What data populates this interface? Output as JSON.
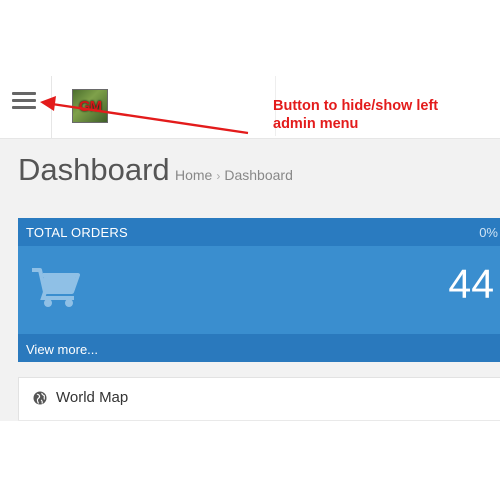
{
  "header": {
    "menu_toggle_icon": "hamburger-icon",
    "logo_text": "GM"
  },
  "annotation": {
    "line1": "Button to hide/show left",
    "line2": "admin menu",
    "color": "#e31b1b"
  },
  "page": {
    "title": "Dashboard",
    "breadcrumb": [
      {
        "label": "Home"
      },
      {
        "label": "Dashboard"
      }
    ],
    "breadcrumb_separator": "›"
  },
  "tile": {
    "heading": "TOTAL ORDERS",
    "percent": "0%",
    "value": "44",
    "icon": "shopping-cart-icon",
    "link": "View more...",
    "color": "#3a8ecf"
  },
  "panel": {
    "icon": "globe-icon",
    "title": "World Map"
  }
}
